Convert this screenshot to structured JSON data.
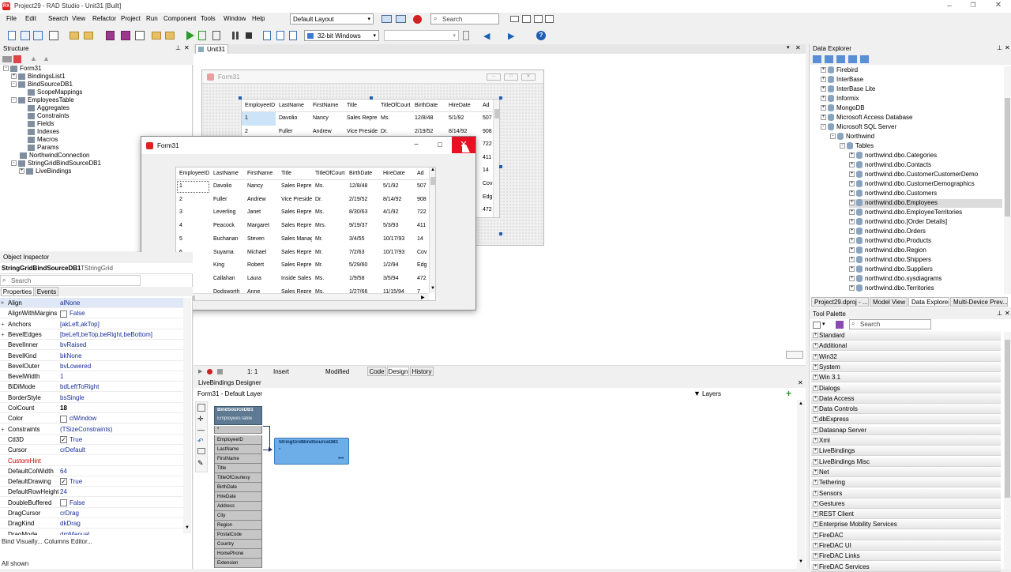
{
  "title": "Project29 - RAD Studio - Unit31 [Built]",
  "menu": [
    "File",
    "Edit",
    "Search",
    "View",
    "Refactor",
    "Project",
    "Run",
    "Component",
    "Tools",
    "Window",
    "Help"
  ],
  "layout_combo": "Default Layout",
  "search_placeholder": "Search",
  "platform_combo": "32-bit Windows",
  "structure": {
    "header": "Structure",
    "items": [
      {
        "label": "Form31",
        "indent": 0,
        "exp": "-"
      },
      {
        "label": "BindingsList1",
        "indent": 1,
        "exp": "+"
      },
      {
        "label": "BindSourceDB1",
        "indent": 1,
        "exp": "-"
      },
      {
        "label": "ScopeMappings",
        "indent": 2,
        "exp": ""
      },
      {
        "label": "EmployeesTable",
        "indent": 1,
        "exp": "-"
      },
      {
        "label": "Aggregates",
        "indent": 2,
        "exp": ""
      },
      {
        "label": "Constraints",
        "indent": 2,
        "exp": ""
      },
      {
        "label": "Fields",
        "indent": 2,
        "exp": ""
      },
      {
        "label": "Indexes",
        "indent": 2,
        "exp": ""
      },
      {
        "label": "Macros",
        "indent": 2,
        "exp": ""
      },
      {
        "label": "Params",
        "indent": 2,
        "exp": ""
      },
      {
        "label": "NorthwindConnection",
        "indent": 1,
        "exp": ""
      },
      {
        "label": "StringGridBindSourceDB1",
        "indent": 1,
        "exp": "-"
      },
      {
        "label": "LiveBindings",
        "indent": 2,
        "exp": "+"
      }
    ]
  },
  "editor_tab": "Unit31",
  "design_form_title": "Form31",
  "grid": {
    "headers": [
      "EmployeeID",
      "LastName",
      "FirstName",
      "Title",
      "TitleOfCourt",
      "BirthDate",
      "HireDate",
      "Ad"
    ],
    "rows": [
      [
        "1",
        "Davolio",
        "Nancy",
        "Sales Repre",
        "Ms.",
        "12/8/48",
        "5/1/92",
        "507"
      ],
      [
        "2",
        "Fuller",
        "Andrew",
        "Vice Preside",
        "Dr.",
        "2/19/52",
        "8/14/92",
        "908"
      ],
      [
        "3",
        "Leverling",
        "Janet",
        "Sales Repre",
        "Ms.",
        "8/30/63",
        "4/1/92",
        "722"
      ],
      [
        "4",
        "Peacock",
        "Margaret",
        "Sales Repre",
        "Mrs.",
        "9/19/37",
        "5/3/93",
        "411"
      ],
      [
        "5",
        "Buchanan",
        "Steven",
        "Sales Manag",
        "Mr.",
        "3/4/55",
        "10/17/93",
        "14"
      ],
      [
        "6",
        "Suyama",
        "Michael",
        "Sales Repre",
        "Mr.",
        "7/2/63",
        "10/17/93",
        "Cov"
      ],
      [
        "7",
        "King",
        "Robert",
        "Sales Repre",
        "Mr.",
        "5/29/60",
        "1/2/94",
        "Edg"
      ],
      [
        "8",
        "Callahan",
        "Laura",
        "Inside Sales",
        "Ms.",
        "1/9/58",
        "3/5/94",
        "472"
      ],
      [
        "9",
        "Dodsworth",
        "Anne",
        "Sales Repre",
        "Ms.",
        "1/27/66",
        "11/15/94",
        "7"
      ]
    ],
    "design_extra": [
      "Cov",
      "Edg",
      "472"
    ]
  },
  "runtime_form_title": "Form31",
  "object_inspector": {
    "header": "Object Inspector",
    "object_name": "StringGridBindSourceDB1",
    "object_type": "TStringGrid",
    "search_placeholder": "Search",
    "tabs": [
      "Properties",
      "Events"
    ],
    "props": [
      {
        "k": "Align",
        "v": "alNone",
        "sel": true
      },
      {
        "k": "AlignWithMargins",
        "v": "False",
        "cb": "off"
      },
      {
        "k": "Anchors",
        "v": "[akLeft,akTop]",
        "exp": "+"
      },
      {
        "k": "BevelEdges",
        "v": "[beLeft,beTop,beRight,beBottom]",
        "exp": "+"
      },
      {
        "k": "BevelInner",
        "v": "bvRaised"
      },
      {
        "k": "BevelKind",
        "v": "bkNone"
      },
      {
        "k": "BevelOuter",
        "v": "bvLowered"
      },
      {
        "k": "BevelWidth",
        "v": "1"
      },
      {
        "k": "BiDiMode",
        "v": "bdLeftToRight"
      },
      {
        "k": "BorderStyle",
        "v": "bsSingle"
      },
      {
        "k": "ColCount",
        "v": "18",
        "bold": true
      },
      {
        "k": "Color",
        "v": "clWindow",
        "swatch": true
      },
      {
        "k": "Constraints",
        "v": "(TSizeConstraints)",
        "exp": "+"
      },
      {
        "k": "Ctl3D",
        "v": "True",
        "cb": "on"
      },
      {
        "k": "Cursor",
        "v": "crDefault"
      },
      {
        "k": "CustomHint",
        "v": "",
        "red": true
      },
      {
        "k": "DefaultColWidth",
        "v": "64"
      },
      {
        "k": "DefaultDrawing",
        "v": "True",
        "cb": "on"
      },
      {
        "k": "DefaultRowHeight",
        "v": "24"
      },
      {
        "k": "DoubleBuffered",
        "v": "False",
        "cb": "off"
      },
      {
        "k": "DragCursor",
        "v": "crDrag"
      },
      {
        "k": "DragKind",
        "v": "dkDrag"
      },
      {
        "k": "DragMode",
        "v": "dmManual"
      }
    ],
    "links": "Bind Visually...   Columns Editor...",
    "status": "All shown"
  },
  "editor_status": {
    "pos": "1:   1",
    "mode": "Insert",
    "state": "Modified",
    "tabs": [
      "Code",
      "Design",
      "History"
    ]
  },
  "livebindings": {
    "header": "LiveBindings Designer",
    "breadcrumb": "Form31  -  Default Layer",
    "layers": "Layers",
    "node1_title": "BindSourceDB1",
    "node1_sub": "EmployeesTable",
    "fields": [
      "*",
      "EmployeeID",
      "LastName",
      "FirstName",
      "Title",
      "TitleOfCourtesy",
      "BirthDate",
      "HireDate",
      "Address",
      "City",
      "Region",
      "PostalCode",
      "Country",
      "HomePhone",
      "Extension"
    ],
    "node2_title": "StringGridBindSourceDB1",
    "node2_sub": "*",
    "node2_more": "•••"
  },
  "data_explorer": {
    "header": "Data Explorer",
    "items": [
      {
        "label": "Firebird",
        "indent": 0,
        "exp": "+"
      },
      {
        "label": "InterBase",
        "indent": 0,
        "exp": "+"
      },
      {
        "label": "InterBase Lite",
        "indent": 0,
        "exp": "+"
      },
      {
        "label": "Informix",
        "indent": 0,
        "exp": "+"
      },
      {
        "label": "MongoDB",
        "indent": 0,
        "exp": "+"
      },
      {
        "label": "Microsoft Access Database",
        "indent": 0,
        "exp": "+"
      },
      {
        "label": "Microsoft SQL Server",
        "indent": 0,
        "exp": "-"
      },
      {
        "label": "Northwind",
        "indent": 1,
        "exp": "-"
      },
      {
        "label": "Tables",
        "indent": 2,
        "exp": "-"
      },
      {
        "label": "northwind.dbo.Categories",
        "indent": 3,
        "exp": "+"
      },
      {
        "label": "northwind.dbo.Contacts",
        "indent": 3,
        "exp": "+"
      },
      {
        "label": "northwind.dbo.CustomerCustomerDemo",
        "indent": 3,
        "exp": "+"
      },
      {
        "label": "northwind.dbo.CustomerDemographics",
        "indent": 3,
        "exp": "+"
      },
      {
        "label": "northwind.dbo.Customers",
        "indent": 3,
        "exp": "+"
      },
      {
        "label": "northwind.dbo.Employees",
        "indent": 3,
        "exp": "+",
        "sel": true
      },
      {
        "label": "northwind.dbo.EmployeeTerritories",
        "indent": 3,
        "exp": "+"
      },
      {
        "label": "northwind.dbo.[Order Details]",
        "indent": 3,
        "exp": "+"
      },
      {
        "label": "northwind.dbo.Orders",
        "indent": 3,
        "exp": "+"
      },
      {
        "label": "northwind.dbo.Products",
        "indent": 3,
        "exp": "+"
      },
      {
        "label": "northwind.dbo.Region",
        "indent": 3,
        "exp": "+"
      },
      {
        "label": "northwind.dbo.Shippers",
        "indent": 3,
        "exp": "+"
      },
      {
        "label": "northwind.dbo.Suppliers",
        "indent": 3,
        "exp": "+"
      },
      {
        "label": "northwind.dbo.sysdiagrams",
        "indent": 3,
        "exp": "+"
      },
      {
        "label": "northwind.dbo.Territories",
        "indent": 3,
        "exp": "+"
      }
    ],
    "tabs": [
      "Project29.dproj - ...",
      "Model View",
      "Data Explorer",
      "Multi-Device Prev..."
    ]
  },
  "tool_palette": {
    "header": "Tool Palette",
    "search_placeholder": "Search",
    "items": [
      "Standard",
      "Additional",
      "Win32",
      "System",
      "Win 3.1",
      "Dialogs",
      "Data Access",
      "Data Controls",
      "dbExpress",
      "Datasnap Server",
      "Xml",
      "LiveBindings",
      "LiveBindings Misc",
      "Net",
      "Tethering",
      "Sensors",
      "Gestures",
      "REST Client",
      "Enterprise Mobility Services",
      "FireDAC",
      "FireDAC UI",
      "FireDAC Links",
      "FireDAC Services"
    ]
  },
  "colors": {
    "accent": "#1e5fb4",
    "close_red": "#e81123",
    "node_header": "#5e7a92",
    "node_blue": "#6eaee8"
  }
}
